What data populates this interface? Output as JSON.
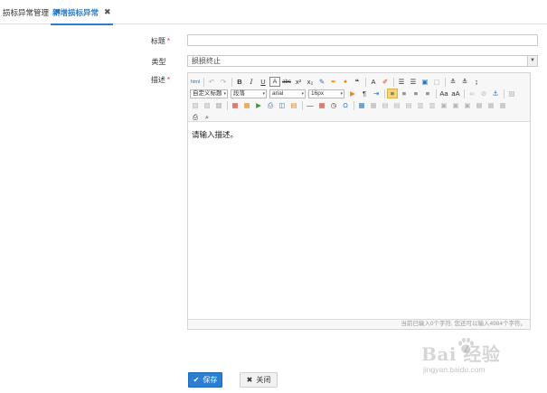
{
  "tabs": [
    {
      "label": "损标异常管理",
      "close": "✖"
    },
    {
      "label": "新增损标异常",
      "close": "✖"
    }
  ],
  "form": {
    "title_label": "标题",
    "type_label": "类型",
    "desc_label": "描述",
    "required_mark": "*",
    "title_value": "",
    "type_value": "损损终止",
    "type_arrow": "▼"
  },
  "toolbar": {
    "custom_title": "自定义标题",
    "paragraph": "段落",
    "font": "arial",
    "size": "16px",
    "buttons_row1": [
      "html",
      "↶",
      "↷",
      "B",
      "I",
      "U",
      "A",
      "abc",
      "x²",
      "x₂",
      "✎",
      "🖌",
      "✦",
      "❝",
      "A",
      "ab",
      "≡",
      "≡",
      "▤",
      "▥",
      "≡",
      "≡",
      "≡"
    ],
    "carat": "▾"
  },
  "editor": {
    "placeholder_text": "请输入描述。",
    "counter": "当前已输入0个字符, 您还可以输入4984个字符。"
  },
  "buttons": {
    "save": "保存",
    "close": "关闭",
    "save_icon": "✔",
    "close_icon": "✖"
  },
  "watermark": {
    "brand": "Bai  经验",
    "url": "jingyan.baidu.com"
  }
}
